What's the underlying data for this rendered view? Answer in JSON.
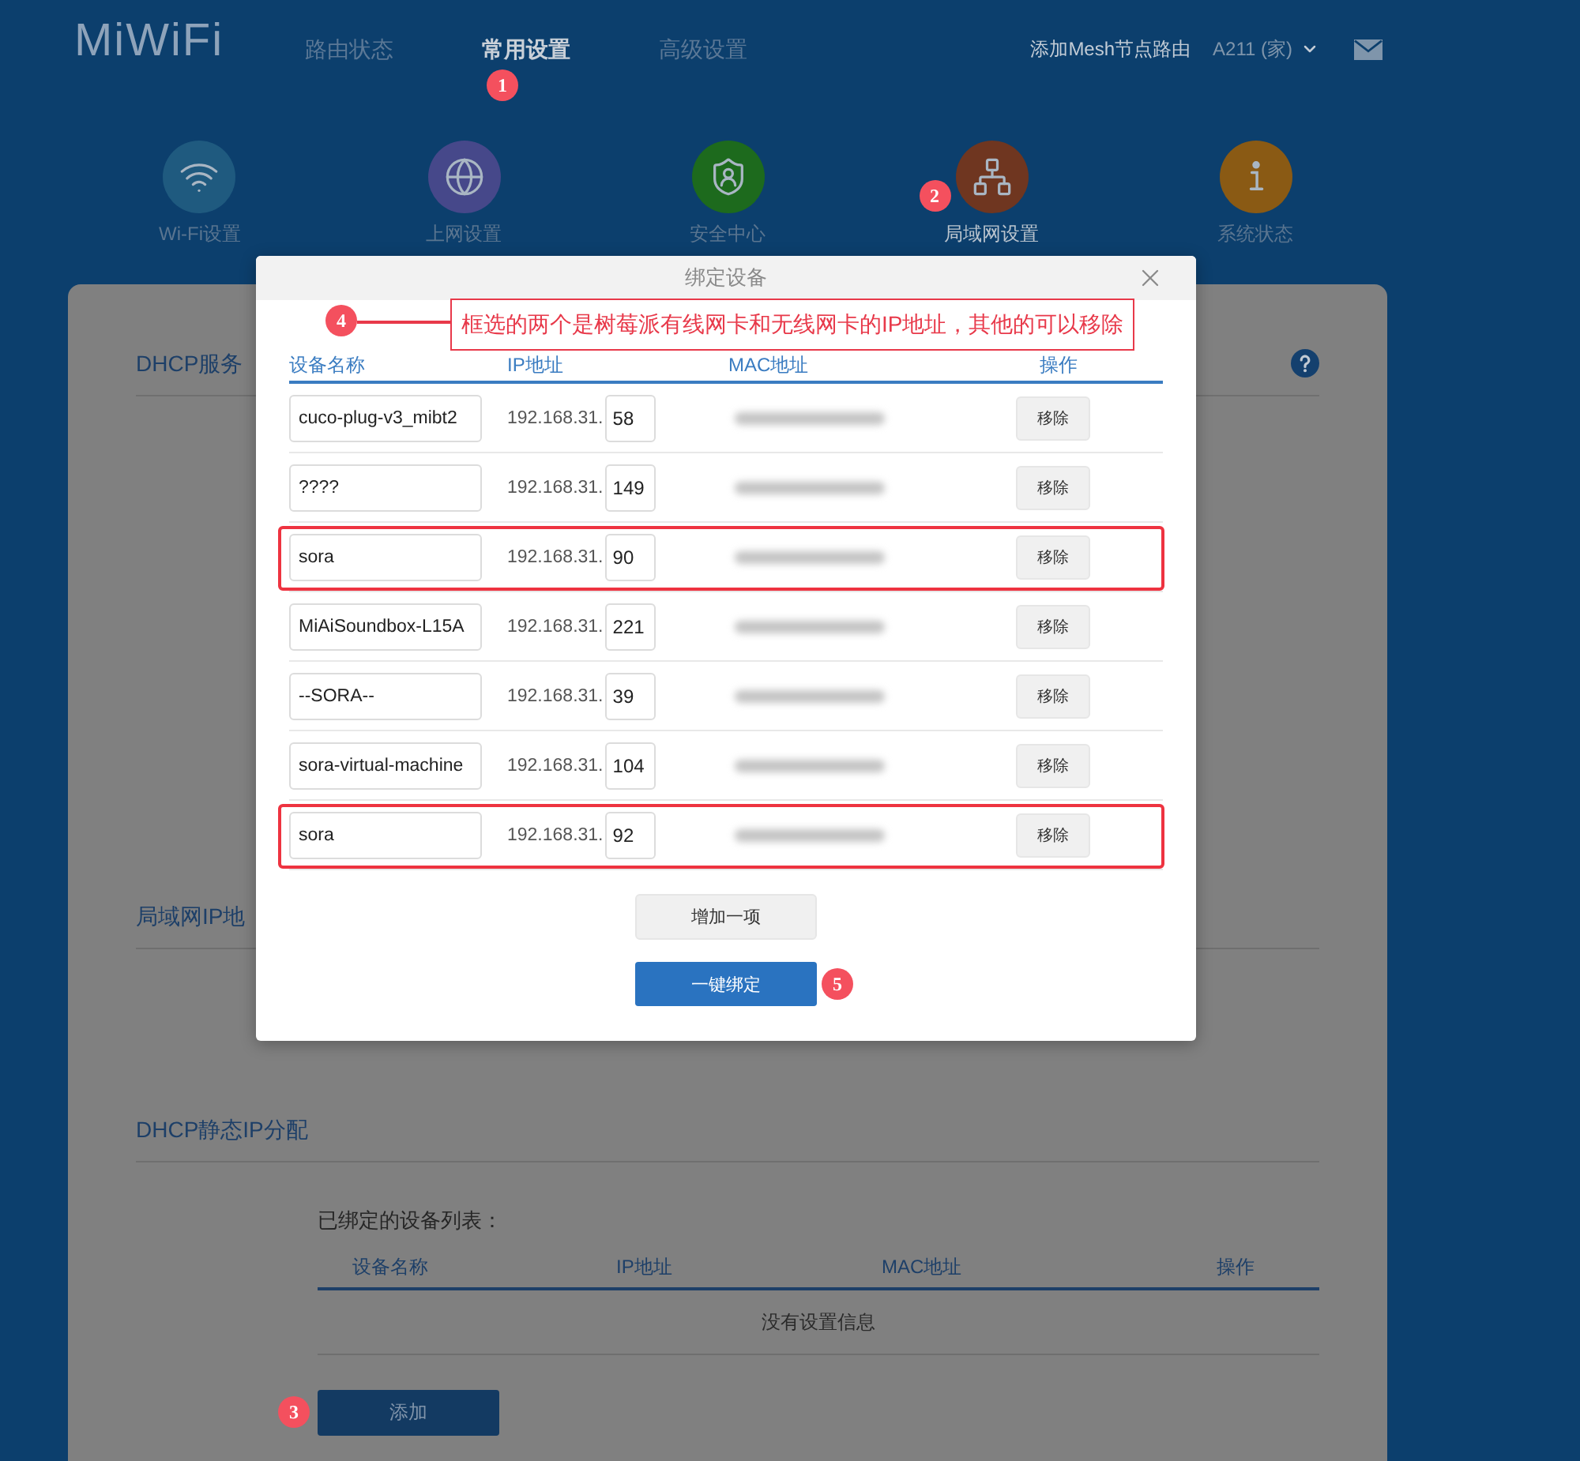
{
  "header": {
    "logo": "MiWiFi",
    "nav": [
      {
        "label": "路由状态",
        "selected": false
      },
      {
        "label": "常用设置",
        "selected": true,
        "marker": "1"
      },
      {
        "label": "高级设置",
        "selected": false
      }
    ],
    "mesh_link": "添加Mesh节点路由",
    "router_menu": "A211 (家)"
  },
  "categories": [
    {
      "label": "Wi-Fi设置",
      "kind": "wifi",
      "color": "#1f5a7f",
      "selected": false
    },
    {
      "label": "上网设置",
      "kind": "globe",
      "color": "#46488a",
      "selected": false
    },
    {
      "label": "安全中心",
      "kind": "shield",
      "color": "#1d6a1d",
      "selected": false
    },
    {
      "label": "局域网设置",
      "kind": "lan",
      "color": "#6f3620",
      "selected": true,
      "marker": "2"
    },
    {
      "label": "系统状态",
      "kind": "info",
      "color": "#8a5a14",
      "selected": false
    }
  ],
  "settings": {
    "sections": [
      {
        "title": "DHCP服务",
        "help": true
      },
      {
        "title": "局域网IP地",
        "help": false
      },
      {
        "title": "DHCP静态IP分配",
        "help": false
      }
    ],
    "bound_list": {
      "label": "已绑定的设备列表：",
      "columns": [
        "设备名称",
        "IP地址",
        "MAC地址",
        "操作"
      ],
      "empty_text": "没有设置信息",
      "add_button": {
        "label": "添加",
        "marker": "3"
      }
    }
  },
  "dialog": {
    "title": "绑定设备",
    "callout": {
      "marker": "4",
      "text": "框选的两个是树莓派有线网卡和无线网卡的IP地址，其他的可以移除"
    },
    "columns": [
      "设备名称",
      "IP地址",
      "MAC地址",
      "操作"
    ],
    "rows": [
      {
        "name": "cuco-plug-v3_mibt2",
        "ip_prefix": "192.168.31.",
        "ip_suffix": "58",
        "action": "移除",
        "highlighted": false
      },
      {
        "name": "????",
        "ip_prefix": "192.168.31.",
        "ip_suffix": "149",
        "action": "移除",
        "highlighted": false
      },
      {
        "name": "sora",
        "ip_prefix": "192.168.31.",
        "ip_suffix": "90",
        "action": "移除",
        "highlighted": true
      },
      {
        "name": "MiAiSoundbox-L15A",
        "ip_prefix": "192.168.31.",
        "ip_suffix": "221",
        "action": "移除",
        "highlighted": false
      },
      {
        "name": "--SORA--",
        "ip_prefix": "192.168.31.",
        "ip_suffix": "39",
        "action": "移除",
        "highlighted": false
      },
      {
        "name": "sora-virtual-machine",
        "ip_prefix": "192.168.31.",
        "ip_suffix": "104",
        "action": "移除",
        "highlighted": false
      },
      {
        "name": "sora",
        "ip_prefix": "192.168.31.",
        "ip_suffix": "92",
        "action": "移除",
        "highlighted": true
      }
    ],
    "add_button": "增加一项",
    "bind_button": {
      "label": "一键绑定",
      "marker": "5"
    }
  }
}
